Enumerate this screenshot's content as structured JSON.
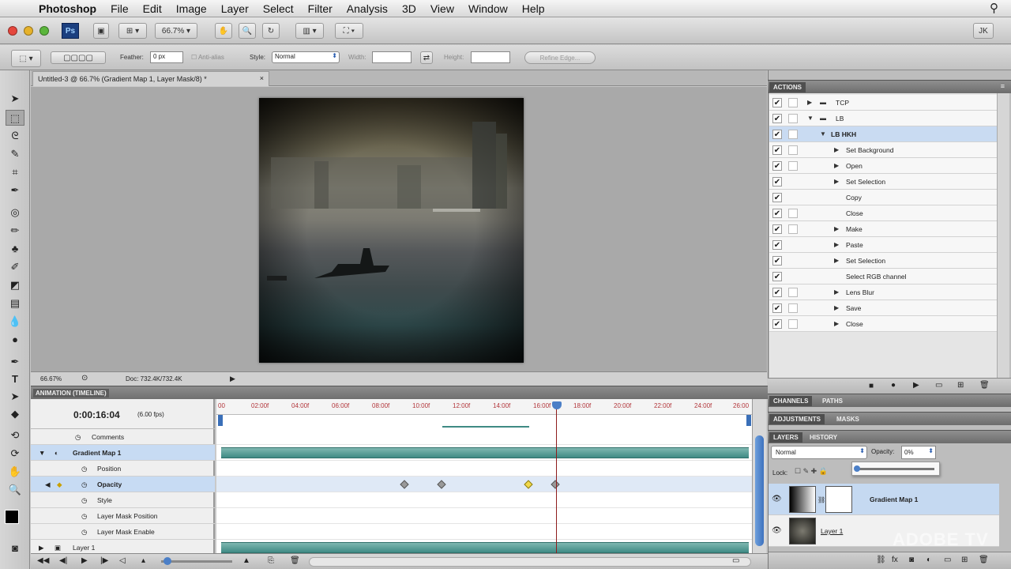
{
  "menubar": {
    "app": "Photoshop",
    "items": [
      "File",
      "Edit",
      "Image",
      "Layer",
      "Select",
      "Filter",
      "Analysis",
      "3D",
      "View",
      "Window",
      "Help"
    ]
  },
  "appbar": {
    "zoom": "66.7%",
    "user": "JK"
  },
  "options": {
    "feather_label": "Feather:",
    "feather_value": "0 px",
    "antialias_label": "Anti-alias",
    "style_label": "Style:",
    "style_value": "Normal",
    "width_label": "Width:",
    "height_label": "Height:",
    "refine_label": "Refine Edge..."
  },
  "document": {
    "tab_title": "Untitled-3 @ 66.7% (Gradient Map 1, Layer Mask/8) *",
    "close": "×"
  },
  "status": {
    "zoom": "66.67%",
    "doc": "Doc: 732.4K/732.4K"
  },
  "timeline": {
    "panel_label": "ANIMATION (TIMELINE)",
    "current_time": "0:00:16:04",
    "fps": "(6.00 fps)",
    "ruler": [
      "00",
      "02:00f",
      "04:00f",
      "06:00f",
      "08:00f",
      "10:00f",
      "12:00f",
      "14:00f",
      "16:00f",
      "18:00f",
      "20:00f",
      "22:00f",
      "24:00f",
      "26:00"
    ],
    "rows": [
      {
        "label": "Comments"
      },
      {
        "label": "Gradient Map 1"
      },
      {
        "label": "Position"
      },
      {
        "label": "Opacity"
      },
      {
        "label": "Style"
      },
      {
        "label": "Layer Mask Position"
      },
      {
        "label": "Layer Mask Enable"
      },
      {
        "label": "Layer 1"
      }
    ]
  },
  "actions": {
    "panel_label": "ACTIONS",
    "items": [
      "TCP",
      "LB",
      "LB HKH",
      "Set Background",
      "Open",
      "Set Selection",
      "Copy",
      "Close",
      "Make",
      "Paste",
      "Set Selection",
      "Select RGB channel",
      "Lens Blur",
      "Save",
      "Close"
    ]
  },
  "channels_tabs": [
    "CHANNELS",
    "PATHS"
  ],
  "adjust_tabs": [
    "ADJUSTMENTS",
    "MASKS"
  ],
  "layers": {
    "tabs": [
      "LAYERS",
      "HISTORY"
    ],
    "blend": "Normal",
    "opacity_label": "Opacity:",
    "opacity_value": "0%",
    "lock_label": "Lock:",
    "items": [
      {
        "name": "Gradient Map 1"
      },
      {
        "name": "Layer 1"
      }
    ]
  },
  "watermark": "ADOBE TV",
  "colors": {
    "accent": "#3f8a84",
    "selection": "#c7dbf3",
    "playhead": "#8e1c1c"
  }
}
